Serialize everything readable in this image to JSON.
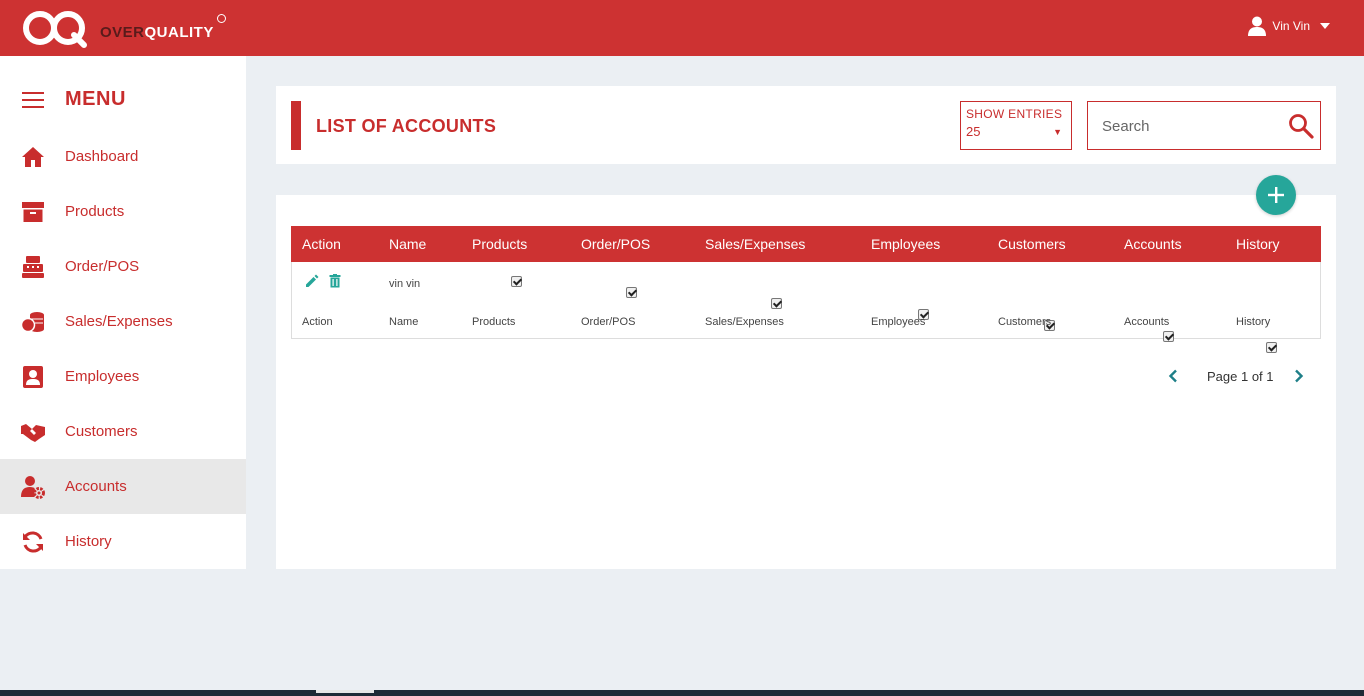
{
  "brand": {
    "name_part1": "OVER",
    "name_part2": "QUALITY",
    "color": "#cd3232"
  },
  "user": {
    "name": "Vin Vin",
    "icon": "user-icon"
  },
  "sidebar": {
    "menu_title": "MENU",
    "items": [
      {
        "label": "Dashboard",
        "icon": "home-icon"
      },
      {
        "label": "Products",
        "icon": "archive-icon"
      },
      {
        "label": "Order/POS",
        "icon": "cash-register-icon"
      },
      {
        "label": "Sales/Expenses",
        "icon": "coins-icon"
      },
      {
        "label": "Employees",
        "icon": "employee-badge-icon"
      },
      {
        "label": "Customers",
        "icon": "handshake-icon"
      },
      {
        "label": "Accounts",
        "icon": "user-cog-icon",
        "active": true
      },
      {
        "label": "History",
        "icon": "refresh-icon"
      }
    ]
  },
  "header": {
    "title": "LIST OF ACCOUNTS",
    "show_entries_label": "SHOW ENTRIES",
    "show_entries_value": "25",
    "search_placeholder": "Search"
  },
  "table": {
    "columns": [
      "Action",
      "Name",
      "Products",
      "Order/POS",
      "Sales/Expenses",
      "Employees",
      "Customers",
      "Accounts",
      "History"
    ],
    "rows": [
      {
        "name": "vin vin",
        "products": true,
        "order_pos": true,
        "sales_expenses": true,
        "employees": true,
        "customers": true,
        "accounts": true,
        "history": true
      }
    ],
    "footer": [
      "Action",
      "Name",
      "Products",
      "Order/POS",
      "Sales/Expenses",
      "Employees",
      "Customers",
      "Accounts",
      "History"
    ]
  },
  "pagination": {
    "text": "Page 1 of 1"
  },
  "colors": {
    "accent": "#c82d2d",
    "teal": "#26a69a",
    "background": "#ebeff3"
  }
}
